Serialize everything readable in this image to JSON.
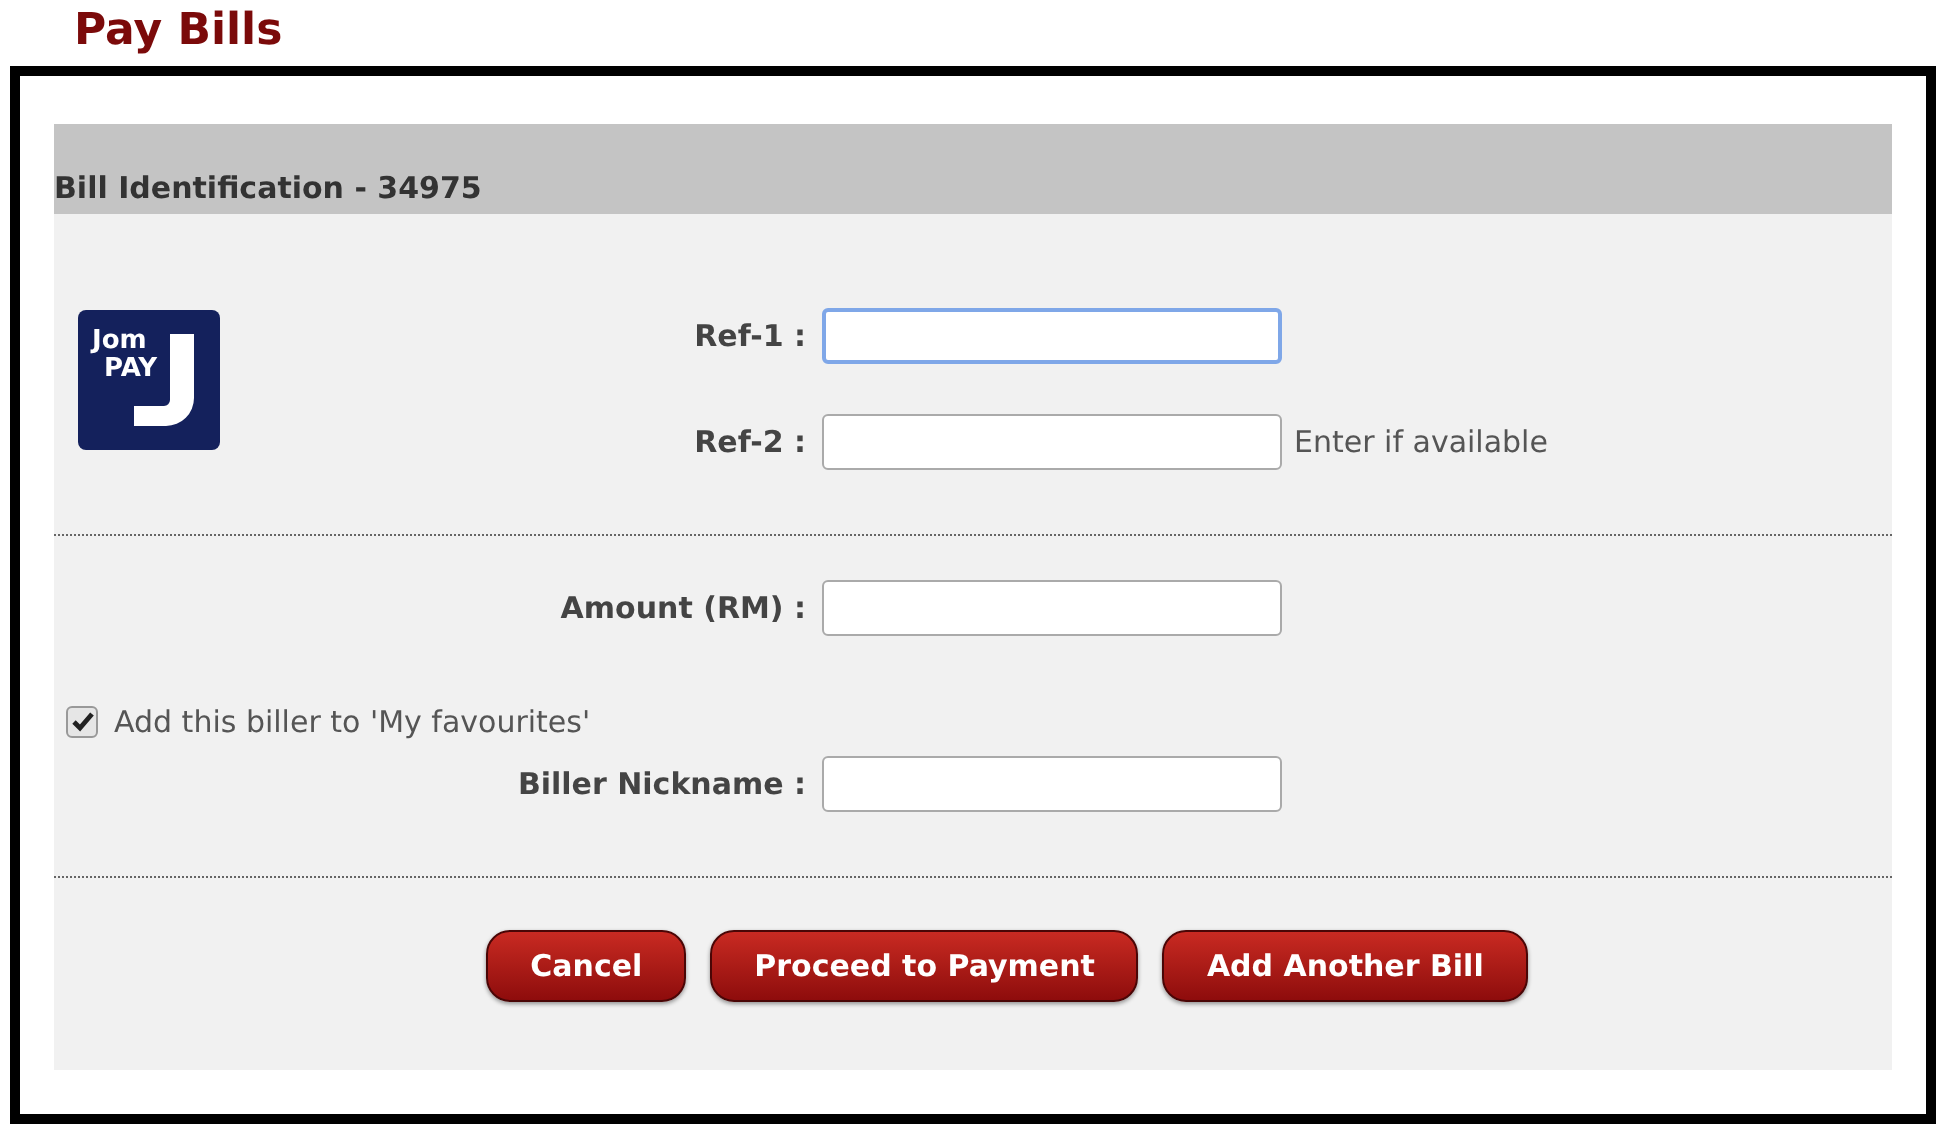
{
  "page_title": "Pay Bills",
  "section": {
    "title": "Bill Identification - 34975"
  },
  "logo": [
    "Jom",
    "PAY"
  ],
  "ref_fields": [
    {
      "label": "Ref-1 :",
      "focused": true
    },
    {
      "label": "Ref-2 :",
      "focused": false,
      "hint": "Enter if available"
    }
  ],
  "amount": {
    "label": "Amount (RM) :"
  },
  "favourite": {
    "label": "Add this biller to 'My favourites'",
    "checked": true
  },
  "nickname": {
    "label": "Biller Nickname :"
  },
  "buttons": [
    "Cancel",
    "Proceed to Payment",
    "Add Another Bill"
  ]
}
